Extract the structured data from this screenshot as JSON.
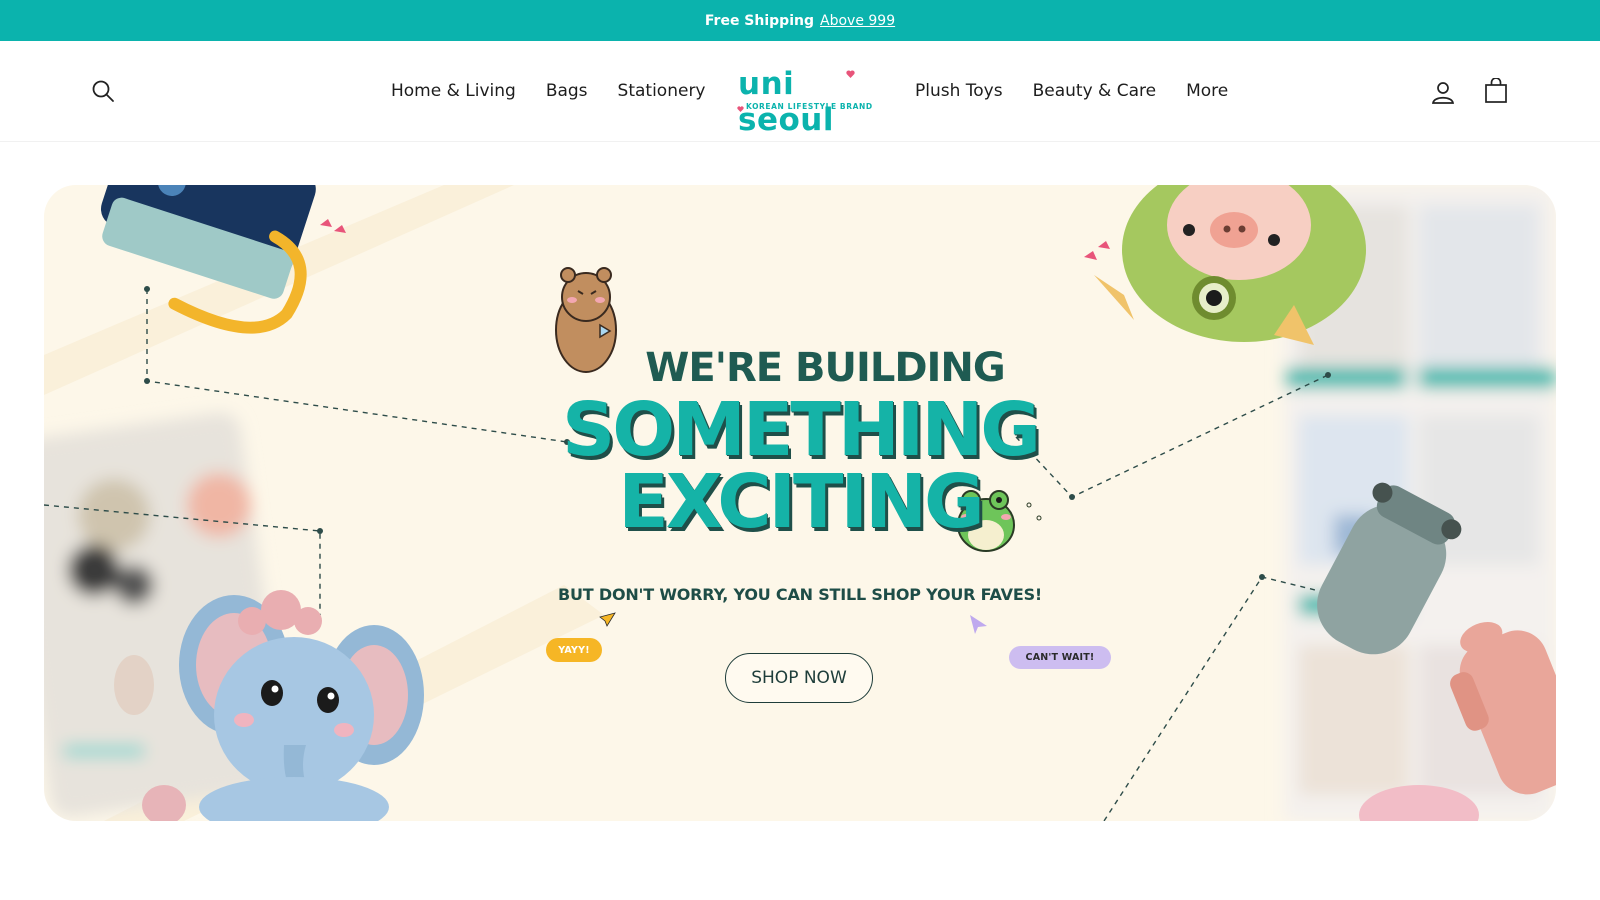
{
  "announcement": {
    "bold_text": "Free Shipping",
    "link_text": "Above 999"
  },
  "header": {
    "nav_left": [
      "Home & Living",
      "Bags",
      "Stationery"
    ],
    "nav_right": [
      "Plush Toys",
      "Beauty & Care",
      "More"
    ],
    "logo": {
      "wordmark": "uni seoul",
      "tagline": "KOREAN LIFESTYLE BRAND"
    },
    "icons": {
      "search": "search-icon",
      "account": "user-icon",
      "cart": "shopping-bag-icon"
    }
  },
  "hero": {
    "headline_line1": "WE'RE BUILDING",
    "headline_line2": "SOMETHING",
    "headline_line3": "EXCITING",
    "subheadline": "BUT DON'T WORRY, YOU CAN STILL SHOP YOUR FAVES!",
    "cta_label": "SHOP NOW",
    "bubble_left": "YAYY!",
    "bubble_right": "CAN'T WAIT!"
  },
  "colors": {
    "brand_teal": "#0bb3ad",
    "headline_dark": "#1f5b52",
    "hero_background": "#fdf7e9",
    "bubble_yellow": "#f6b625",
    "bubble_lavender": "#cdbdf0"
  }
}
